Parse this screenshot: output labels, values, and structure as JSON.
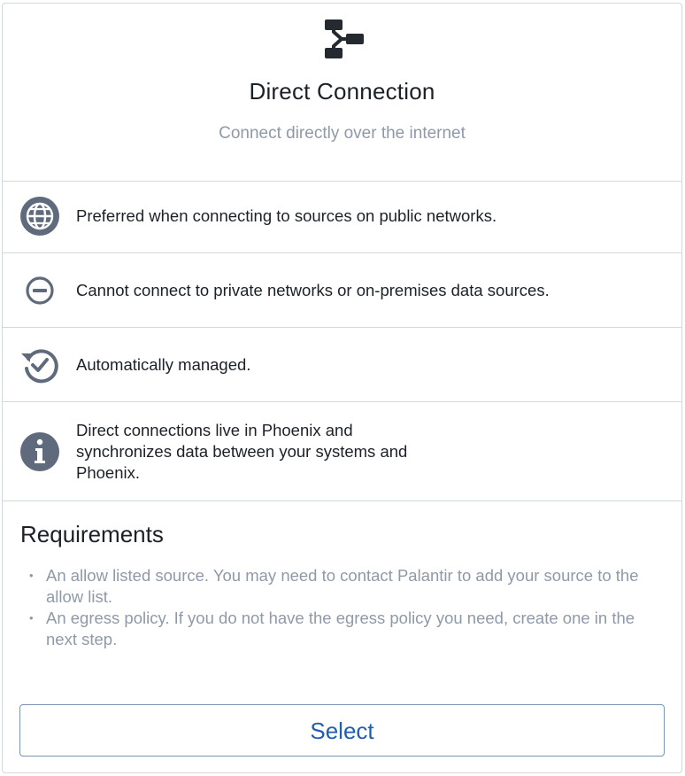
{
  "header": {
    "icon": "data-connection-icon",
    "title": "Direct Connection",
    "subtitle": "Connect directly over the internet"
  },
  "features": [
    {
      "icon": "globe-icon",
      "text": "Preferred when connecting to sources on public networks."
    },
    {
      "icon": "minus-circle-icon",
      "text": "Cannot connect to private networks or on-premises data sources."
    },
    {
      "icon": "history-check-icon",
      "text": "Automatically managed."
    },
    {
      "icon": "info-icon",
      "text": "Direct connections live in Phoenix and synchronizes data between your systems and Phoenix."
    }
  ],
  "requirements": {
    "title": "Requirements",
    "items": [
      "An allow listed source. You may need to contact Palantir to add your source to the allow list.",
      "An egress policy. If you do not have the egress policy you need, create one in the next step."
    ]
  },
  "select_button": {
    "label": "Select"
  },
  "colors": {
    "icon": "#5f6b7c",
    "header_icon": "#252a31",
    "text": "#1c2127",
    "muted": "#8f99a8",
    "border": "#d3d8de",
    "primary": "#215db0"
  }
}
